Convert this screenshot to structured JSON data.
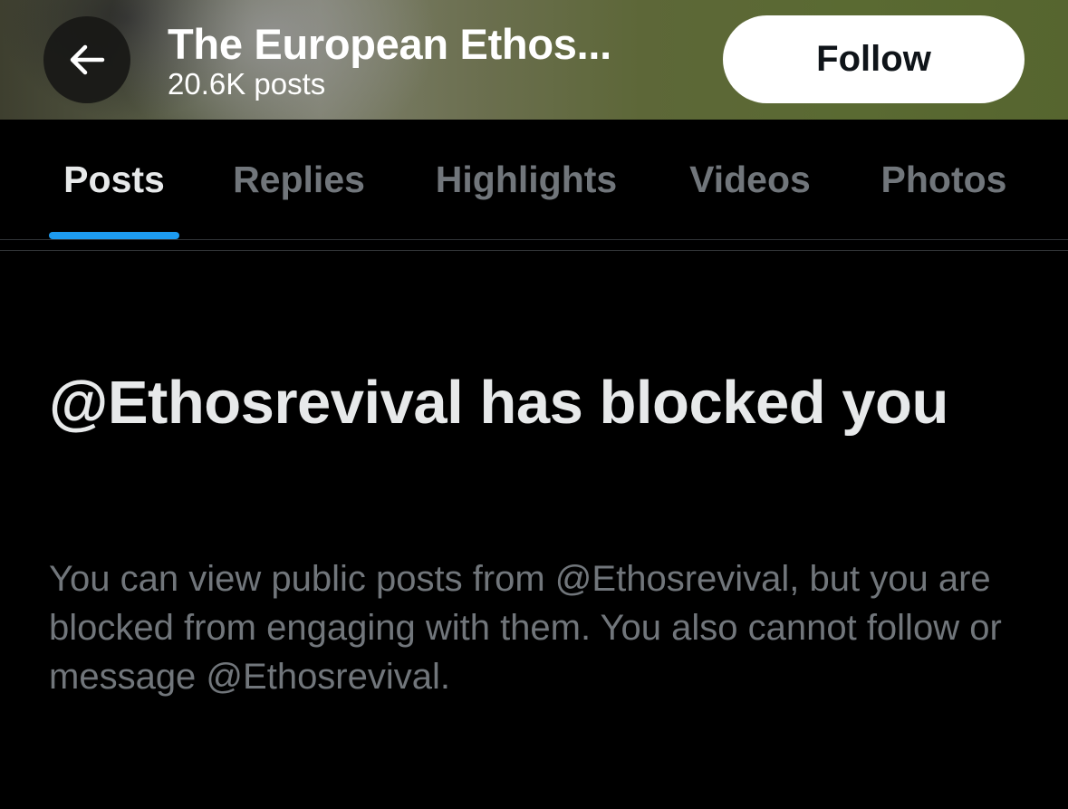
{
  "header": {
    "title": "The European Ethos...",
    "post_count": "20.6K posts",
    "follow_label": "Follow"
  },
  "icons": {
    "back": "arrow-left-icon"
  },
  "tabs": [
    {
      "label": "Posts",
      "active": true
    },
    {
      "label": "Replies",
      "active": false
    },
    {
      "label": "Highlights",
      "active": false
    },
    {
      "label": "Videos",
      "active": false
    },
    {
      "label": "Photos",
      "active": false
    }
  ],
  "blocked": {
    "heading": "@Ethosrevival has blocked you",
    "body": "You can view public posts from @Ethosrevival, but you are blocked from engaging with them. You also cannot follow or message @Ethosrevival."
  },
  "colors": {
    "background": "#000000",
    "accent": "#1d9bf0",
    "text_primary": "#e7e9ea",
    "text_secondary": "#71767b"
  }
}
